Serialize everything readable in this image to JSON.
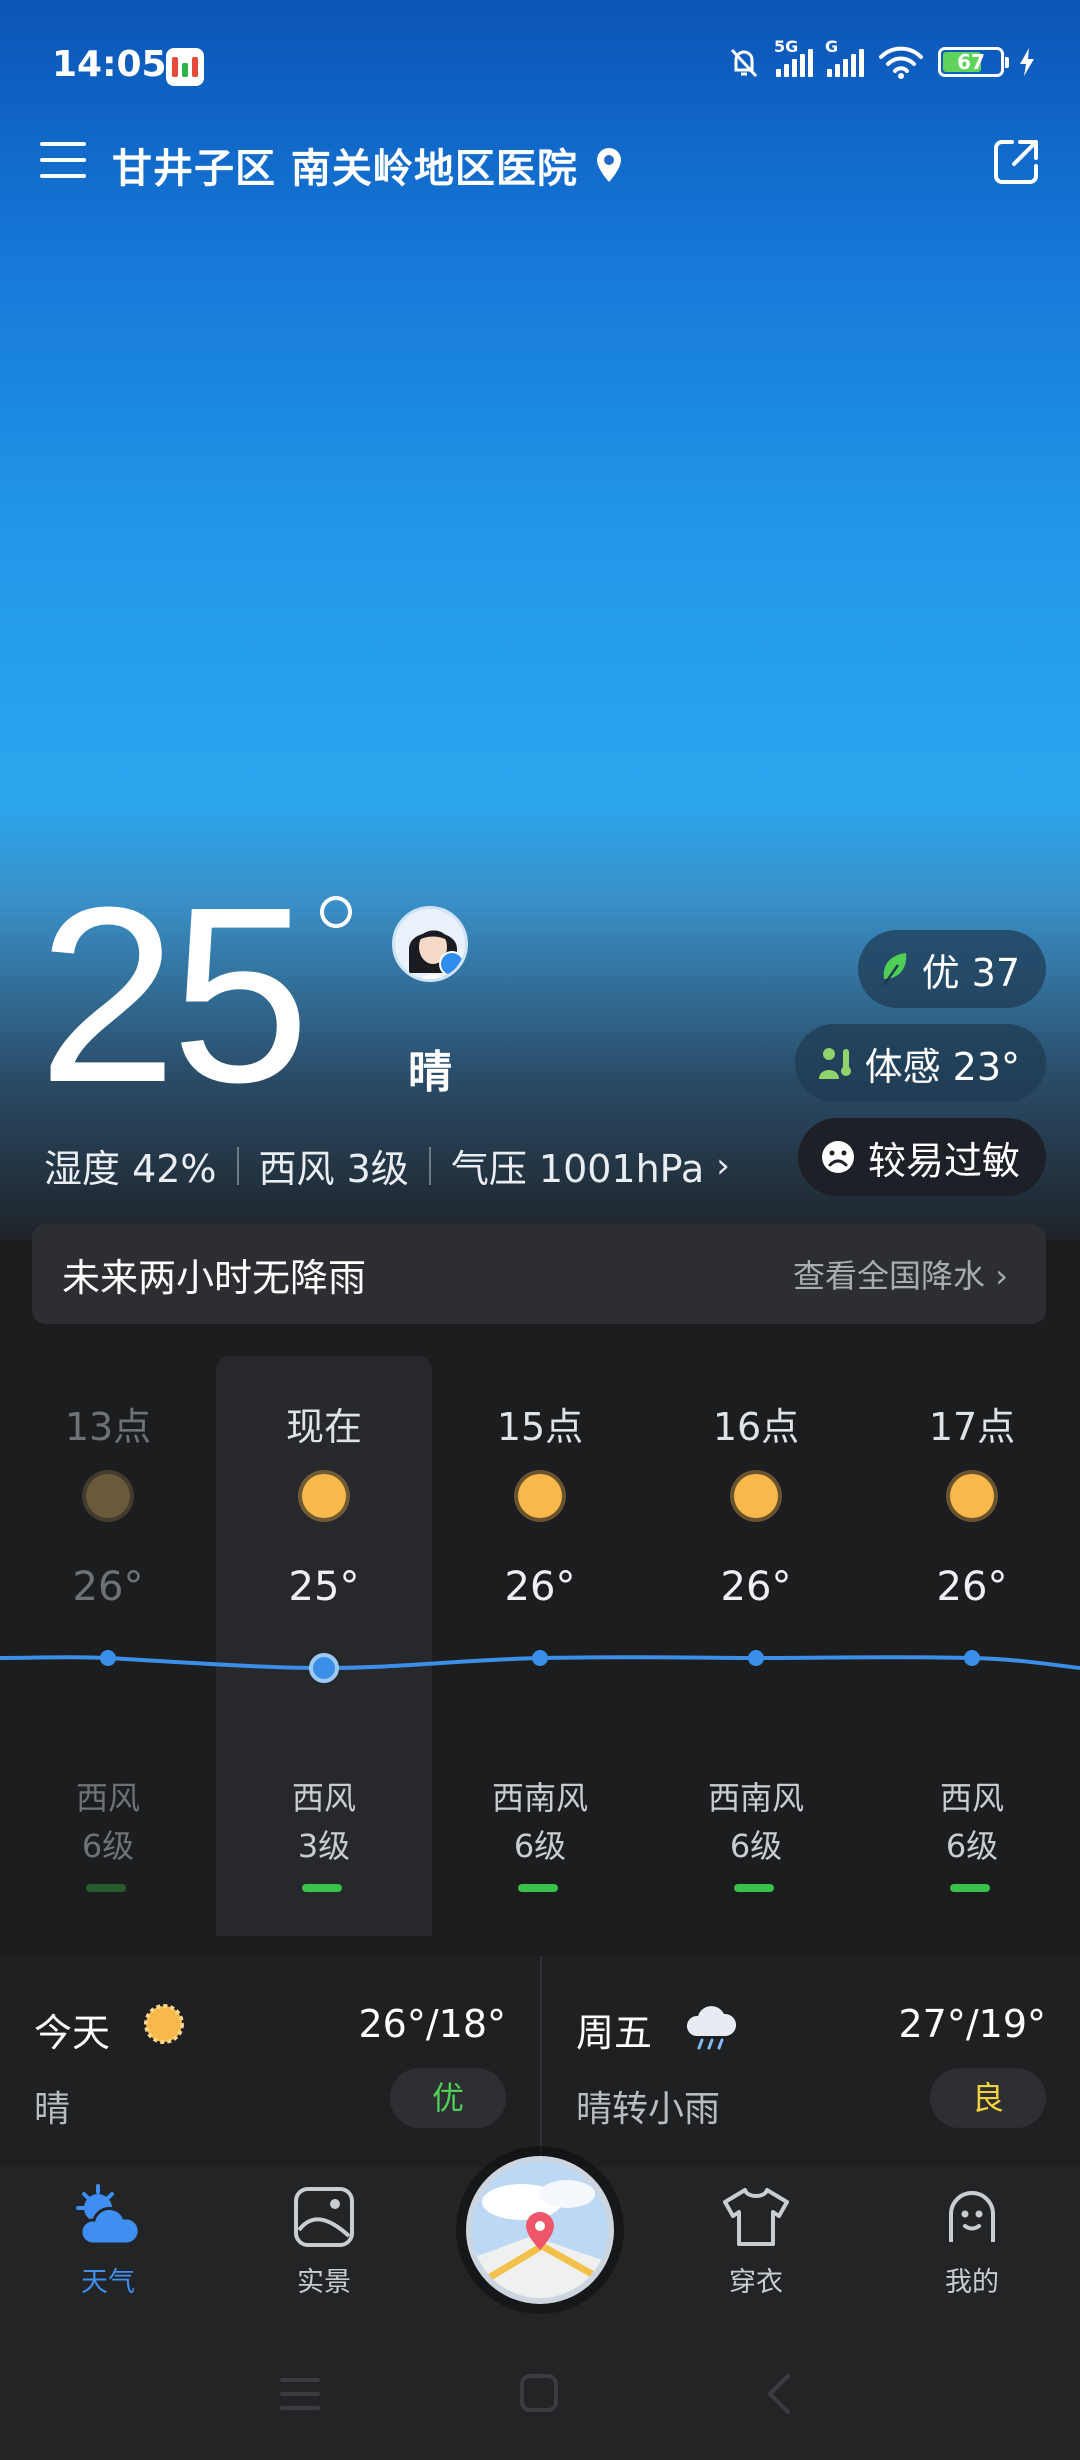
{
  "status_bar": {
    "time": "14:05",
    "signal1_tag": "5G",
    "signal2_tag": "G",
    "battery_level": "67"
  },
  "header": {
    "location": "甘井子区 南关岭地区医院"
  },
  "current": {
    "temperature": "25",
    "condition": "晴",
    "humidity": "湿度 42%",
    "wind": "西风 3级",
    "pressure": "气压 1001hPa",
    "aqi_label": "优 37",
    "feels_like": "体感 23°",
    "allergy": "较易过敏"
  },
  "precipitation": {
    "message": "未来两小时无降雨",
    "link": "查看全国降水"
  },
  "hourly": [
    {
      "hour": "13点",
      "temp": "26°",
      "wind_dir": "西风",
      "wind_level": "6级"
    },
    {
      "hour": "现在",
      "temp": "25°",
      "wind_dir": "西风",
      "wind_level": "3级"
    },
    {
      "hour": "15点",
      "temp": "26°",
      "wind_dir": "西南风",
      "wind_level": "6级"
    },
    {
      "hour": "16点",
      "temp": "26°",
      "wind_dir": "西南风",
      "wind_level": "6级"
    },
    {
      "hour": "17点",
      "temp": "26°",
      "wind_dir": "西风",
      "wind_level": "6级"
    }
  ],
  "daily": [
    {
      "name": "今天",
      "range": "26°/18°",
      "desc": "晴",
      "quality": "优"
    },
    {
      "name": "周五",
      "range": "27°/19°",
      "desc": "晴转小雨",
      "quality": "良"
    }
  ],
  "nav": {
    "weather": "天气",
    "scene": "实景",
    "clothing": "穿衣",
    "mine": "我的"
  },
  "colors": {
    "accent": "#3f8ff2",
    "good": "#4fcf55",
    "moderate": "#f1d33c"
  }
}
